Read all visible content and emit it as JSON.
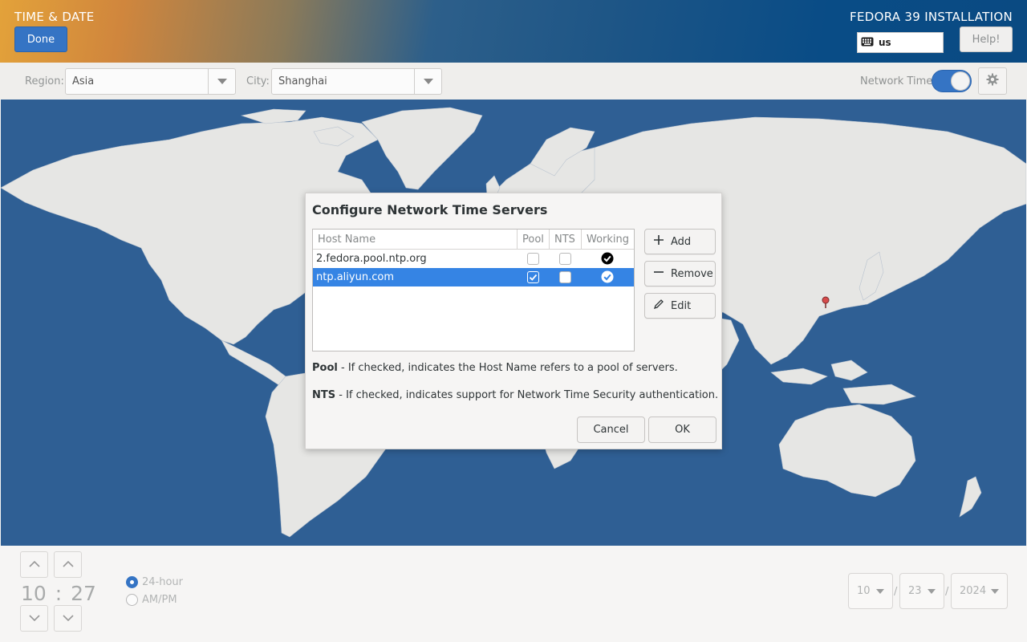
{
  "header": {
    "spoke_title": "TIME & DATE",
    "done_label": "Done",
    "product_title": "FEDORA 39 INSTALLATION",
    "keyboard_layout": "us",
    "help_label": "Help!"
  },
  "controls": {
    "region_label": "Region:",
    "region_value": "Asia",
    "city_label": "City:",
    "city_value": "Shanghai",
    "network_time_label": "Network Time",
    "network_time_on": true
  },
  "time": {
    "hours": "10",
    "separator": ":",
    "minutes": "27",
    "format_24_label": "24-hour",
    "format_ampm_label": "AM/PM",
    "selected_format": "24-hour"
  },
  "date": {
    "month": "10",
    "day": "23",
    "year": "2024",
    "separator": "/"
  },
  "dialog": {
    "title": "Configure Network Time Servers",
    "columns": [
      "Host Name",
      "Pool",
      "NTS",
      "Working"
    ],
    "servers": [
      {
        "host": "2.fedora.pool.ntp.org",
        "pool": false,
        "nts": false,
        "working": true,
        "selected": false
      },
      {
        "host": "ntp.aliyun.com",
        "pool": true,
        "nts": false,
        "working": true,
        "selected": true
      }
    ],
    "add_label": "Add",
    "remove_label": "Remove",
    "edit_label": "Edit",
    "pool_term": "Pool",
    "pool_help": " - If checked, indicates the Host Name refers to a pool of servers.",
    "nts_term": "NTS",
    "nts_help": " - If checked, indicates support for Network Time Security authentication.",
    "cancel_label": "Cancel",
    "ok_label": "OK"
  },
  "colors": {
    "accent": "#3574c4",
    "selection": "#3584e4",
    "ocean": "#2f5f94",
    "land": "#e6e6e4"
  }
}
